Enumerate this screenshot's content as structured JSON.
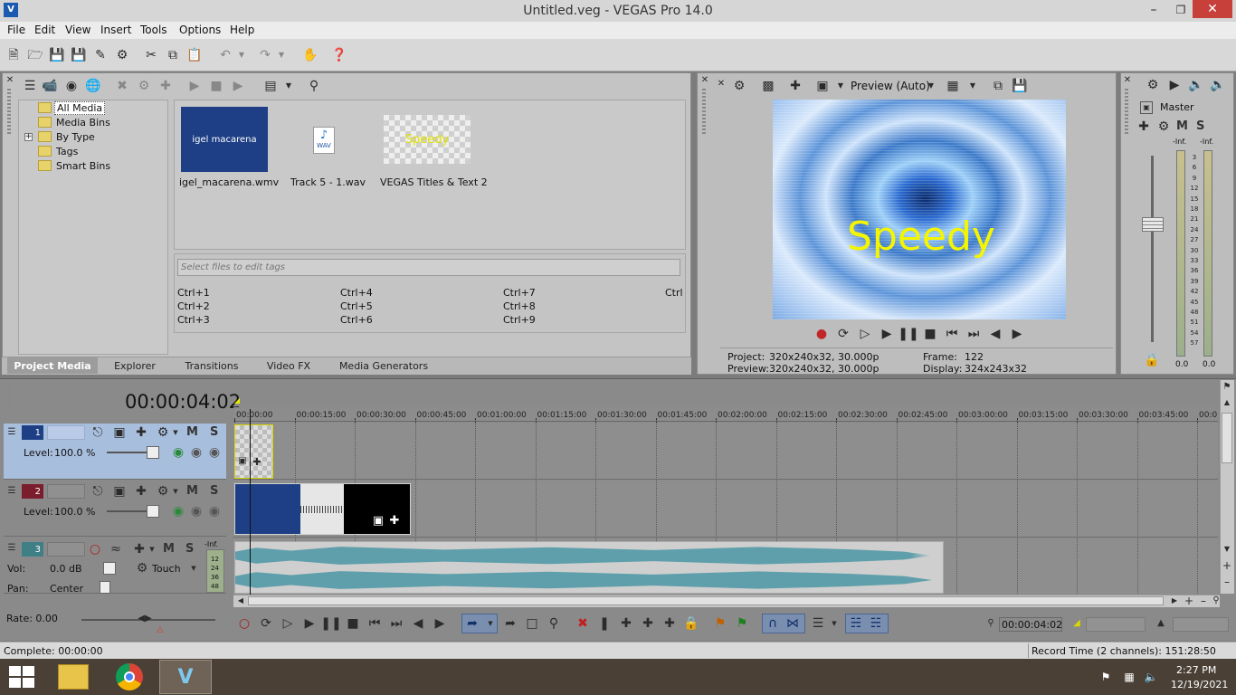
{
  "window": {
    "title": "Untitled.veg - VEGAS Pro 14.0"
  },
  "menu": [
    "File",
    "Edit",
    "View",
    "Insert",
    "Tools",
    "Options",
    "Help"
  ],
  "media_tree": {
    "items": [
      "All Media",
      "Media Bins",
      "By Type",
      "Tags",
      "Smart Bins"
    ]
  },
  "media_files": [
    {
      "name": "igel_macarena.wmv",
      "thumb_text": "igel macarena"
    },
    {
      "name": "Track 5 - 1.wav",
      "thumb_text": "WAV"
    },
    {
      "name": "VEGAS Titles & Text 2",
      "thumb_text": "Speedy"
    }
  ],
  "tags": {
    "placeholder": "Select files to edit tags",
    "shortcuts": [
      "Ctrl+1",
      "Ctrl+4",
      "Ctrl+7",
      "Ctrl",
      "Ctrl+2",
      "Ctrl+5",
      "Ctrl+8",
      "Ctrl+3",
      "Ctrl+6",
      "Ctrl+9"
    ]
  },
  "tabs": [
    "Project Media",
    "Explorer",
    "Transitions",
    "Video FX",
    "Media Generators"
  ],
  "preview": {
    "mode_label": "Preview (Auto)",
    "overlay_text": "Speedy",
    "project_label": "Project:",
    "project_value": "320x240x32, 30.000p",
    "preview_label": "Preview:",
    "preview_value": "320x240x32, 30.000p",
    "frame_label": "Frame:",
    "frame_value": "122",
    "display_label": "Display:",
    "display_value": "324x243x32"
  },
  "master": {
    "title": "Master",
    "inf_left": "-Inf.",
    "inf_right": "-Inf.",
    "scale": [
      "3",
      "6",
      "9",
      "12",
      "15",
      "18",
      "21",
      "24",
      "27",
      "30",
      "33",
      "36",
      "39",
      "42",
      "45",
      "48",
      "51",
      "54",
      "57"
    ],
    "level_left": "0.0",
    "level_right": "0.0"
  },
  "timeline": {
    "timecode": "00:00:04:02",
    "ruler": [
      "00:00:00",
      "00:00:15:00",
      "00:00:30:00",
      "00:00:45:00",
      "00:01:00:00",
      "00:01:15:00",
      "00:01:30:00",
      "00:01:45:00",
      "00:02:00:00",
      "00:02:15:00",
      "00:02:30:00",
      "00:02:45:00",
      "00:03:00:00",
      "00:03:15:00",
      "00:03:30:00",
      "00:03:45:00",
      "00:0"
    ]
  },
  "tracks": [
    {
      "num": "1",
      "level_label": "Level:",
      "level_value": "100.0 %",
      "m": "M",
      "s": "S"
    },
    {
      "num": "2",
      "level_label": "Level:",
      "level_value": "100.0 %",
      "m": "M",
      "s": "S"
    },
    {
      "num": "3",
      "vol_label": "Vol:",
      "vol_value": "0.0 dB",
      "pan_label": "Pan:",
      "pan_value": "Center",
      "automation": "Touch",
      "m": "M",
      "s": "S",
      "inf": "-Inf.",
      "scale": [
        "12",
        "24",
        "36",
        "48"
      ]
    }
  ],
  "transport": {
    "rate_label": "Rate: 0.00",
    "cursor_time": "00:00:04:02"
  },
  "status": {
    "complete": "Complete: 00:00:00",
    "record_time": "Record Time (2 channels): 151:28:50"
  },
  "taskbar": {
    "time": "2:27 PM",
    "date": "12/19/2021"
  },
  "colors": {
    "timeline_bg": "#8a8a8a",
    "track_selected": "#a8bedd",
    "waveform": "#5f9fab",
    "accent": "#1f4e8a"
  }
}
